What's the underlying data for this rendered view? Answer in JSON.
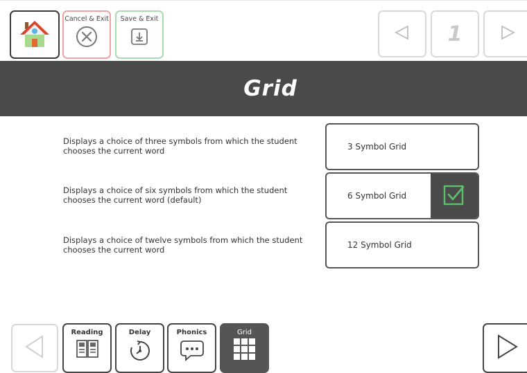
{
  "toolbar": {
    "cancel_label": "Cancel & Exit",
    "save_label": "Save & Exit",
    "page_number": "1"
  },
  "page": {
    "title": "Grid"
  },
  "options": [
    {
      "description": "Displays a choice of three symbols from which the student chooses the current word",
      "label": "3 Symbol Grid",
      "selected": false
    },
    {
      "description": "Displays a choice of six symbols from which the student chooses the current word (default)",
      "label": "6 Symbol Grid",
      "selected": true
    },
    {
      "description": "Displays a choice of twelve symbols from which the student chooses the current word",
      "label": "12 Symbol Grid",
      "selected": false
    }
  ],
  "tabs": [
    {
      "label": "Reading",
      "icon": "book-icon"
    },
    {
      "label": "Delay",
      "icon": "timer-icon"
    },
    {
      "label": "Phonics",
      "icon": "speech-bubble-icon"
    },
    {
      "label": "Grid",
      "icon": "grid-icon",
      "active": true
    }
  ],
  "colors": {
    "title_bar": "#4a4a4a",
    "cancel_border": "#f0a3a3",
    "save_border": "#a6dcb0",
    "check_green": "#5cc06a"
  }
}
